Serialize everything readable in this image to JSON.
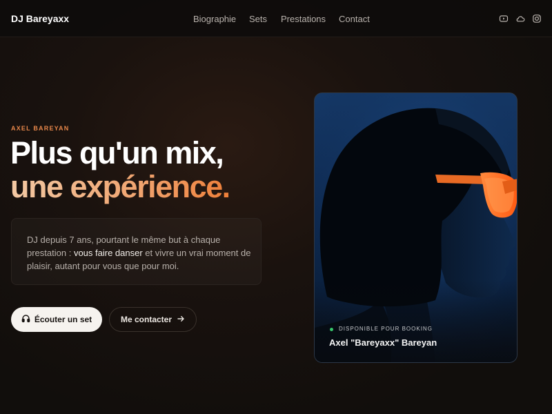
{
  "header": {
    "brand": "DJ Bareyaxx",
    "nav": [
      "Biographie",
      "Sets",
      "Prestations",
      "Contact"
    ],
    "social_icons": [
      "youtube-icon",
      "soundcloud-icon",
      "instagram-icon"
    ]
  },
  "hero": {
    "eyebrow": "AXEL BAREYAN",
    "title_line1": "Plus qu'un mix,",
    "title_line2": "une expérience.",
    "description": {
      "before": "DJ depuis 7 ans, pourtant le même but à chaque prestation : ",
      "highlight": "vous faire danser",
      "after": " et vivre un vrai moment de plaisir, autant pour vous que pour moi."
    },
    "primary_button": {
      "label": "Écouter un set",
      "icon": "headphones-icon"
    },
    "secondary_button": {
      "label": "Me contacter",
      "icon": "arrow-right-icon"
    }
  },
  "card": {
    "status": "DISPONIBLE POUR BOOKING",
    "name": "Axel \"Bareyaxx\" Bareyan"
  },
  "colors": {
    "accent": "#e8874a",
    "status_green": "#37c66b",
    "background": "#15100d"
  }
}
